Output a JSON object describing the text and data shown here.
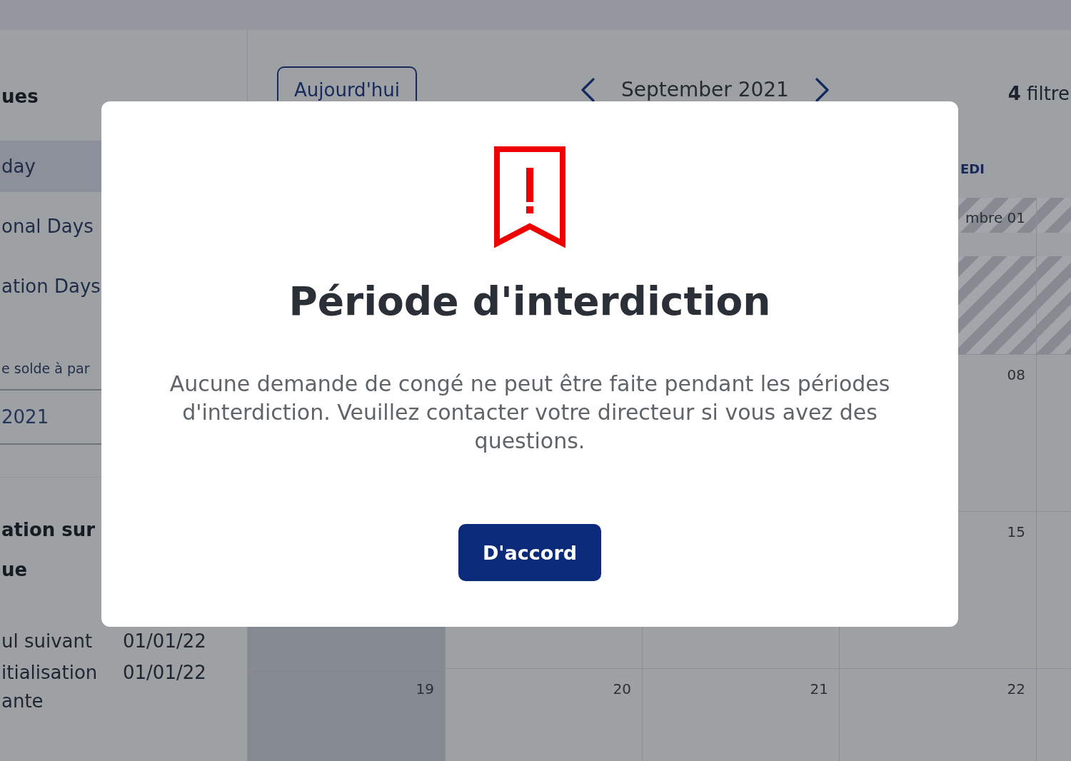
{
  "sidebar": {
    "heading": "ues",
    "items": [
      {
        "label": "day",
        "selected": true
      },
      {
        "label": "onal Days",
        "selected": false
      },
      {
        "label": "ation Days",
        "selected": false
      }
    ],
    "date_field": {
      "label": "e solde à par",
      "value": "2021"
    },
    "summary_heading": [
      "ation sur",
      "ue"
    ],
    "summary_rows": [
      {
        "label": [
          "ul suivant"
        ],
        "value": "01/01/22"
      },
      {
        "label": [
          "itialisation",
          "ante"
        ],
        "value": "01/01/22"
      }
    ]
  },
  "calendar": {
    "today_button": "Aujourd'hui",
    "month": "September 2021",
    "filters": "**4** filtre",
    "weekdays": [
      {
        "weekend": true
      },
      {
        "weekend": false
      },
      {
        "weekend": false
      },
      {
        "label": "EDI",
        "weekend": false
      },
      {
        "weekend": false
      }
    ],
    "weeks": [
      {
        "days": [
          {
            "date": "mbre 01",
            "blackout": true
          },
          {
            "blackout": true
          }
        ]
      },
      {
        "days": [
          {
            "date": "08",
            "blackout": false
          },
          {
            "blackout": false
          }
        ]
      },
      {
        "days": [
          {
            "blackout": false
          },
          {
            "blackout": false
          },
          {
            "blackout": false
          },
          {
            "date": "15",
            "blackout": false
          },
          {
            "blackout": false
          }
        ]
      },
      {
        "days": [
          {
            "date": "19",
            "blackout": false
          },
          {
            "date": "20",
            "blackout": false
          },
          {
            "date": "21",
            "blackout": false
          },
          {
            "date": "22",
            "blackout": false
          },
          {
            "blackout": false
          }
        ]
      }
    ]
  },
  "dialog": {
    "title": "Période d'interdiction",
    "message": "Aucune demande de congé ne peut être faite pendant les périodes d'interdiction. Veuillez contacter votre directeur si vous avez des questions.",
    "button": "D'accord"
  }
}
